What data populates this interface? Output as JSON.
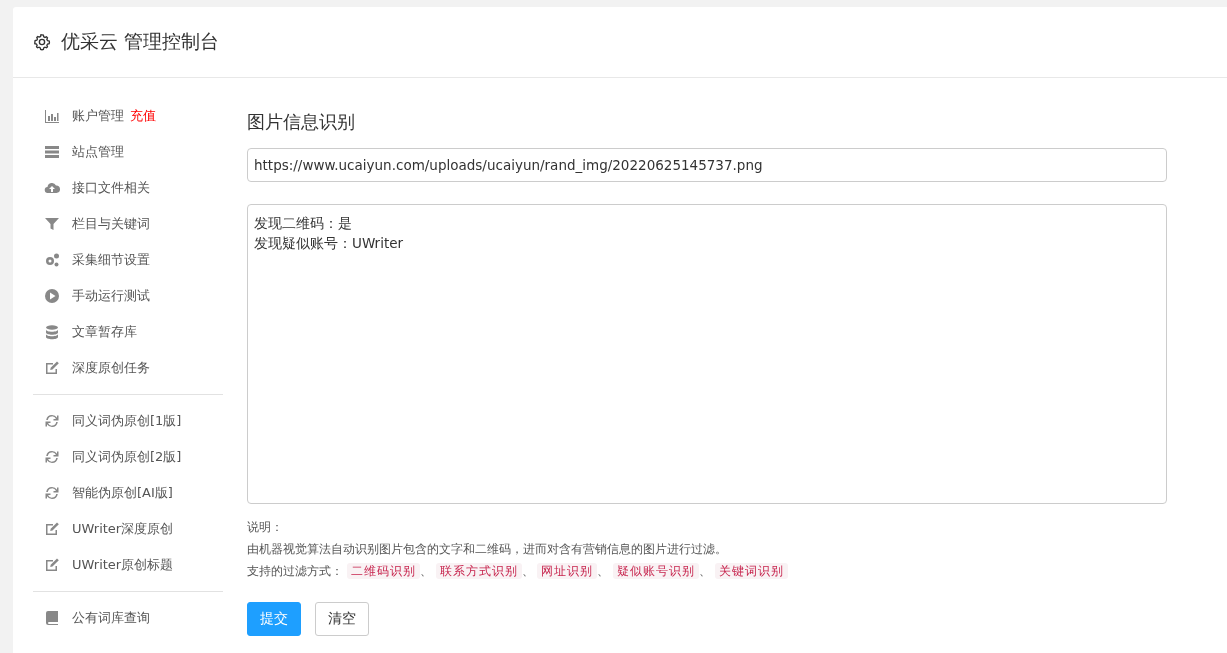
{
  "header": {
    "title": "优采云 管理控制台"
  },
  "sidebar": {
    "groups": [
      {
        "items": [
          {
            "kind": "chart",
            "label": "账户管理",
            "badge": "充值"
          },
          {
            "kind": "server",
            "label": "站点管理"
          },
          {
            "kind": "cloud",
            "label": "接口文件相关"
          },
          {
            "kind": "filter",
            "label": "栏目与关键词"
          },
          {
            "kind": "gears",
            "label": "采集细节设置"
          },
          {
            "kind": "play",
            "label": "手动运行测试"
          },
          {
            "kind": "database",
            "label": "文章暂存库"
          },
          {
            "kind": "edit",
            "label": "深度原创任务"
          }
        ]
      },
      {
        "items": [
          {
            "kind": "refresh",
            "label": "同义词伪原创[1版]"
          },
          {
            "kind": "refresh",
            "label": "同义词伪原创[2版]"
          },
          {
            "kind": "refresh",
            "label": "智能伪原创[AI版]"
          },
          {
            "kind": "edit",
            "label": "UWriter深度原创"
          },
          {
            "kind": "edit",
            "label": "UWriter原创标题"
          }
        ]
      },
      {
        "items": [
          {
            "kind": "book",
            "label": "公有词库查询"
          }
        ]
      }
    ]
  },
  "main": {
    "title": "图片信息识别",
    "url_field": {
      "value": "https://www.ucaiyun.com/uploads/ucaiyun/rand_img/20220625145737.png"
    },
    "result_field": {
      "lines": [
        "发现二维码：是",
        "发现疑似账号：UWriter"
      ]
    },
    "notes": {
      "heading": "说明：",
      "description": "由机器视觉算法自动识别图片包含的文字和二维码，进而对含有营销信息的图片进行过滤。",
      "methods_label": "支持的过滤方式：",
      "methods": [
        "二维码识别",
        "联系方式识别",
        "网址识别",
        "疑似账号识别",
        "关键词识别"
      ],
      "separator": "、"
    },
    "buttons": [
      {
        "label": "提交",
        "kind": "primary"
      },
      {
        "label": "清空",
        "kind": "default"
      }
    ]
  }
}
